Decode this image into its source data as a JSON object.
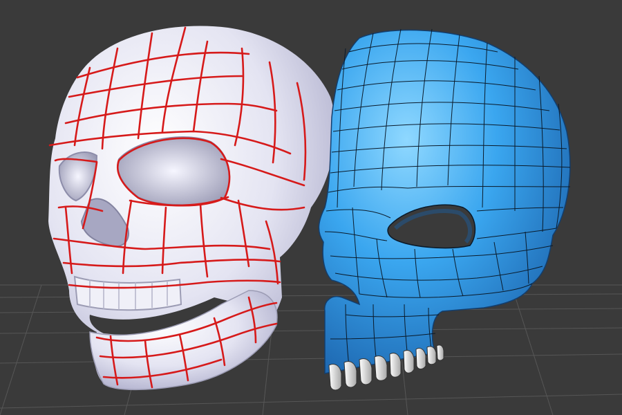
{
  "viewport": {
    "background": "#3a3a3a",
    "grid_color": "#6e6e6e"
  },
  "models": [
    {
      "name": "sculpted-skull",
      "surface_color": "#e6e6f4",
      "guide_line_color": "#d61a1a"
    },
    {
      "name": "retopo-skull-mesh",
      "surface_color": "#2f95e0",
      "wire_color": "#0a1a2a",
      "teeth_color": "#e9e9e9"
    }
  ]
}
